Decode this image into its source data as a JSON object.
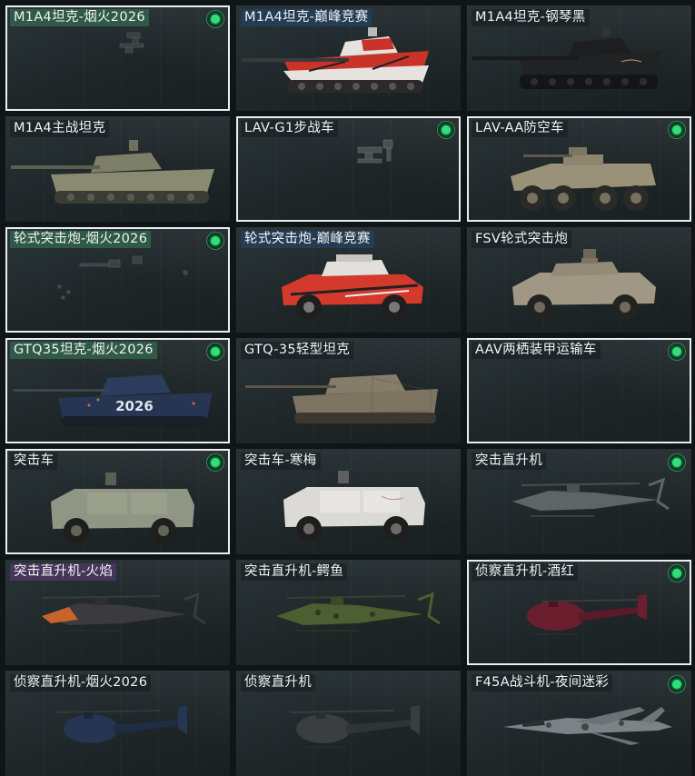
{
  "vehicles": [
    {
      "title": "M1A4坦克-烟火2026",
      "selected": true,
      "checked": true,
      "hl": "green",
      "icon": "tank-turret-icon"
    },
    {
      "title": "M1A4坦克-巅峰竞赛",
      "selected": false,
      "checked": false,
      "hl": "blue",
      "icon": "tank-icon"
    },
    {
      "title": "M1A4坦克-钢琴黑",
      "selected": false,
      "checked": false,
      "hl": "",
      "icon": "tank-icon"
    },
    {
      "title": "M1A4主战坦克",
      "selected": false,
      "checked": false,
      "hl": "",
      "icon": "tank-icon"
    },
    {
      "title": "LAV-G1步战车",
      "selected": true,
      "checked": true,
      "hl": "",
      "icon": "turret-icon"
    },
    {
      "title": "LAV-AA防空车",
      "selected": true,
      "checked": true,
      "hl": "",
      "icon": "apc-icon"
    },
    {
      "title": "轮式突击炮-烟火2026",
      "selected": true,
      "checked": true,
      "hl": "green",
      "icon": "turret-icon"
    },
    {
      "title": "轮式突击炮-巅峰竞赛",
      "selected": false,
      "checked": false,
      "hl": "blue",
      "icon": "armored-car-icon"
    },
    {
      "title": "FSV轮式突击炮",
      "selected": false,
      "checked": false,
      "hl": "",
      "icon": "armored-car-icon"
    },
    {
      "title": "GTQ35坦克-烟火2026",
      "selected": true,
      "checked": true,
      "hl": "green",
      "icon": "tank-icon"
    },
    {
      "title": "GTQ-35轻型坦克",
      "selected": false,
      "checked": false,
      "hl": "",
      "icon": "tank-icon"
    },
    {
      "title": "AAV两栖装甲运输车",
      "selected": true,
      "checked": true,
      "hl": "",
      "icon": "amphibious-vehicle-icon"
    },
    {
      "title": "突击车",
      "selected": true,
      "checked": true,
      "hl": "",
      "icon": "assault-truck-icon"
    },
    {
      "title": "突击车-寒梅",
      "selected": false,
      "checked": false,
      "hl": "",
      "icon": "assault-truck-icon"
    },
    {
      "title": "突击直升机",
      "selected": false,
      "checked": true,
      "hl": "",
      "icon": "attack-helicopter-icon"
    },
    {
      "title": "突击直升机-火焰",
      "selected": false,
      "checked": false,
      "hl": "purple",
      "icon": "attack-helicopter-icon"
    },
    {
      "title": "突击直升机-鳄鱼",
      "selected": false,
      "checked": false,
      "hl": "",
      "icon": "attack-helicopter-icon"
    },
    {
      "title": "侦察直升机-酒红",
      "selected": true,
      "checked": true,
      "hl": "",
      "icon": "scout-helicopter-icon"
    },
    {
      "title": "侦察直升机-烟火2026",
      "selected": false,
      "checked": false,
      "hl": "",
      "icon": "scout-helicopter-icon"
    },
    {
      "title": "侦察直升机",
      "selected": false,
      "checked": false,
      "hl": "",
      "icon": "scout-helicopter-icon"
    },
    {
      "title": "F45A战斗机-夜间迷彩",
      "selected": false,
      "checked": true,
      "hl": "",
      "icon": "fighter-jet-icon"
    }
  ],
  "skin_colors": {
    "olive": "#8a8a72",
    "red": "#d33a2c",
    "black": "#1d1d1f",
    "navy": "#253552",
    "tan": "#9a9179",
    "sand": "#a09784",
    "white": "#dcdad6",
    "gray": "#5f6465",
    "flame": "#c8642a",
    "croc": "#4c5e32",
    "wine": "#6b1f2e",
    "camo": "#7d8286"
  },
  "livery_texts": {
    "gtq35_fireworks": "2026"
  }
}
